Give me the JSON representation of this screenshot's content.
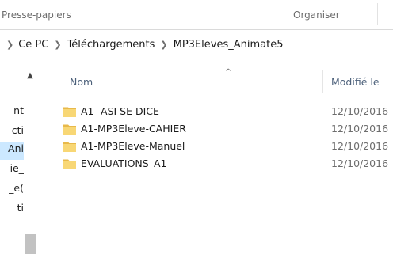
{
  "ribbon": {
    "groups": [
      "Presse-papiers",
      "Organiser"
    ]
  },
  "address_bar": {
    "crumbs": [
      "Ce PC",
      "Téléchargements",
      "MP3Eleves_Animate5"
    ],
    "separator_icon": "chevron-right-icon"
  },
  "nav_pane": {
    "items": [
      {
        "label": "nt",
        "selected": false
      },
      {
        "label": "cti",
        "selected": false
      },
      {
        "label": "Ani",
        "selected": true
      },
      {
        "label": "ie_",
        "selected": false
      },
      {
        "label": "_e(",
        "selected": false
      },
      {
        "label": "ti",
        "selected": false
      }
    ],
    "scroll_up_icon": "chevron-up-icon"
  },
  "columns": {
    "name": "Nom",
    "modified": "Modifié le",
    "sort_icon": "sort-ascending-icon"
  },
  "files": [
    {
      "name": "A1- ASI SE DICE",
      "date": "12/10/2016",
      "icon": "folder-icon"
    },
    {
      "name": "A1-MP3Eleve-CAHIER",
      "date": "12/10/2016",
      "icon": "folder-icon"
    },
    {
      "name": "A1-MP3Eleve-Manuel",
      "date": "12/10/2016",
      "icon": "folder-icon"
    },
    {
      "name": "EVALUATIONS_A1",
      "date": "12/10/2016",
      "icon": "folder-icon"
    }
  ],
  "colors": {
    "folder": "#f8d775",
    "folder_dark": "#e8b94a",
    "selection": "#cce8ff",
    "header_text": "#4c607a"
  }
}
